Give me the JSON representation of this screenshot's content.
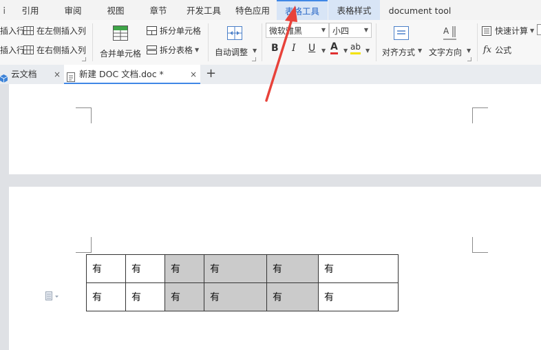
{
  "menu_tabs": [
    {
      "label": "引用"
    },
    {
      "label": "审阅"
    },
    {
      "label": "视图"
    },
    {
      "label": "章节"
    },
    {
      "label": "开发工具"
    },
    {
      "label": "特色应用"
    },
    {
      "label": "表格工具",
      "active": true
    },
    {
      "label": "表格样式"
    },
    {
      "label": "document tool"
    }
  ],
  "ribbon": {
    "insert_row_above": "插入行",
    "insert_row_below": "插入行",
    "insert_col_left": "在左侧插入列",
    "insert_col_right": "在右侧插入列",
    "merge_cells": "合并单元格",
    "split_cells": "拆分单元格",
    "split_table": "拆分表格",
    "auto_fit": "自动调整",
    "font_name": "微软雅黑",
    "font_size": "小四",
    "bold": "B",
    "italic": "I",
    "underline": "U",
    "font_color_glyph": "A",
    "highlight_glyph": "ab",
    "alignment": "对齐方式",
    "text_direction": "文字方向",
    "quick_calc": "快速计算",
    "formula_symbol": "fx",
    "formula": "公式"
  },
  "doc_tabs": [
    {
      "label": "云文档"
    },
    {
      "label": "新建 DOC 文档.doc *",
      "active": true
    }
  ],
  "new_tab_glyph": "+",
  "close_glyph": "×",
  "table": {
    "rows": [
      [
        "有",
        "有",
        "有",
        "有",
        "有",
        "有"
      ],
      [
        "有",
        "有",
        "有",
        "有",
        "有",
        "有"
      ]
    ]
  },
  "colors": {
    "accent": "#3f87e6",
    "active_tab_text": "#2b69c7",
    "selected_cell": "#cbcbcb",
    "annotation_arrow": "#e8423a"
  }
}
